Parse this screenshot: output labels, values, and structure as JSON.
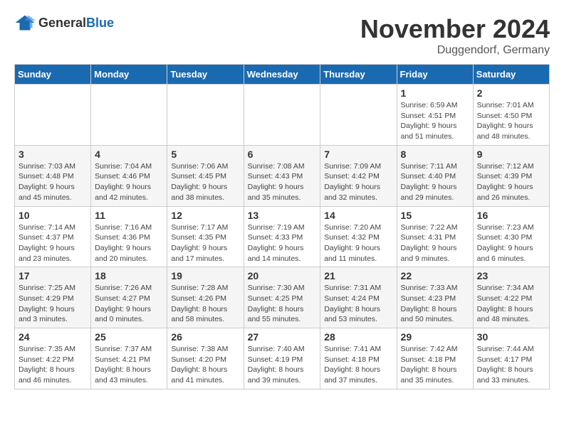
{
  "header": {
    "logo_general": "General",
    "logo_blue": "Blue",
    "title": "November 2024",
    "location": "Duggendorf, Germany"
  },
  "calendar": {
    "headers": [
      "Sunday",
      "Monday",
      "Tuesday",
      "Wednesday",
      "Thursday",
      "Friday",
      "Saturday"
    ],
    "weeks": [
      [
        {
          "day": "",
          "info": ""
        },
        {
          "day": "",
          "info": ""
        },
        {
          "day": "",
          "info": ""
        },
        {
          "day": "",
          "info": ""
        },
        {
          "day": "",
          "info": ""
        },
        {
          "day": "1",
          "info": "Sunrise: 6:59 AM\nSunset: 4:51 PM\nDaylight: 9 hours and 51 minutes."
        },
        {
          "day": "2",
          "info": "Sunrise: 7:01 AM\nSunset: 4:50 PM\nDaylight: 9 hours and 48 minutes."
        }
      ],
      [
        {
          "day": "3",
          "info": "Sunrise: 7:03 AM\nSunset: 4:48 PM\nDaylight: 9 hours and 45 minutes."
        },
        {
          "day": "4",
          "info": "Sunrise: 7:04 AM\nSunset: 4:46 PM\nDaylight: 9 hours and 42 minutes."
        },
        {
          "day": "5",
          "info": "Sunrise: 7:06 AM\nSunset: 4:45 PM\nDaylight: 9 hours and 38 minutes."
        },
        {
          "day": "6",
          "info": "Sunrise: 7:08 AM\nSunset: 4:43 PM\nDaylight: 9 hours and 35 minutes."
        },
        {
          "day": "7",
          "info": "Sunrise: 7:09 AM\nSunset: 4:42 PM\nDaylight: 9 hours and 32 minutes."
        },
        {
          "day": "8",
          "info": "Sunrise: 7:11 AM\nSunset: 4:40 PM\nDaylight: 9 hours and 29 minutes."
        },
        {
          "day": "9",
          "info": "Sunrise: 7:12 AM\nSunset: 4:39 PM\nDaylight: 9 hours and 26 minutes."
        }
      ],
      [
        {
          "day": "10",
          "info": "Sunrise: 7:14 AM\nSunset: 4:37 PM\nDaylight: 9 hours and 23 minutes."
        },
        {
          "day": "11",
          "info": "Sunrise: 7:16 AM\nSunset: 4:36 PM\nDaylight: 9 hours and 20 minutes."
        },
        {
          "day": "12",
          "info": "Sunrise: 7:17 AM\nSunset: 4:35 PM\nDaylight: 9 hours and 17 minutes."
        },
        {
          "day": "13",
          "info": "Sunrise: 7:19 AM\nSunset: 4:33 PM\nDaylight: 9 hours and 14 minutes."
        },
        {
          "day": "14",
          "info": "Sunrise: 7:20 AM\nSunset: 4:32 PM\nDaylight: 9 hours and 11 minutes."
        },
        {
          "day": "15",
          "info": "Sunrise: 7:22 AM\nSunset: 4:31 PM\nDaylight: 9 hours and 9 minutes."
        },
        {
          "day": "16",
          "info": "Sunrise: 7:23 AM\nSunset: 4:30 PM\nDaylight: 9 hours and 6 minutes."
        }
      ],
      [
        {
          "day": "17",
          "info": "Sunrise: 7:25 AM\nSunset: 4:29 PM\nDaylight: 9 hours and 3 minutes."
        },
        {
          "day": "18",
          "info": "Sunrise: 7:26 AM\nSunset: 4:27 PM\nDaylight: 9 hours and 0 minutes."
        },
        {
          "day": "19",
          "info": "Sunrise: 7:28 AM\nSunset: 4:26 PM\nDaylight: 8 hours and 58 minutes."
        },
        {
          "day": "20",
          "info": "Sunrise: 7:30 AM\nSunset: 4:25 PM\nDaylight: 8 hours and 55 minutes."
        },
        {
          "day": "21",
          "info": "Sunrise: 7:31 AM\nSunset: 4:24 PM\nDaylight: 8 hours and 53 minutes."
        },
        {
          "day": "22",
          "info": "Sunrise: 7:33 AM\nSunset: 4:23 PM\nDaylight: 8 hours and 50 minutes."
        },
        {
          "day": "23",
          "info": "Sunrise: 7:34 AM\nSunset: 4:22 PM\nDaylight: 8 hours and 48 minutes."
        }
      ],
      [
        {
          "day": "24",
          "info": "Sunrise: 7:35 AM\nSunset: 4:22 PM\nDaylight: 8 hours and 46 minutes."
        },
        {
          "day": "25",
          "info": "Sunrise: 7:37 AM\nSunset: 4:21 PM\nDaylight: 8 hours and 43 minutes."
        },
        {
          "day": "26",
          "info": "Sunrise: 7:38 AM\nSunset: 4:20 PM\nDaylight: 8 hours and 41 minutes."
        },
        {
          "day": "27",
          "info": "Sunrise: 7:40 AM\nSunset: 4:19 PM\nDaylight: 8 hours and 39 minutes."
        },
        {
          "day": "28",
          "info": "Sunrise: 7:41 AM\nSunset: 4:18 PM\nDaylight: 8 hours and 37 minutes."
        },
        {
          "day": "29",
          "info": "Sunrise: 7:42 AM\nSunset: 4:18 PM\nDaylight: 8 hours and 35 minutes."
        },
        {
          "day": "30",
          "info": "Sunrise: 7:44 AM\nSunset: 4:17 PM\nDaylight: 8 hours and 33 minutes."
        }
      ]
    ]
  }
}
